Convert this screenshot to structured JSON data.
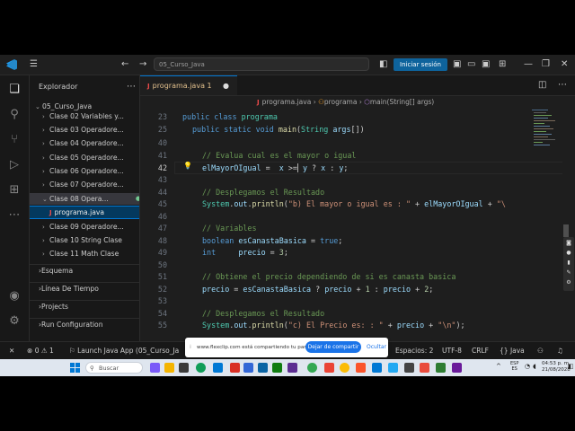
{
  "titlebar": {
    "command_center": "05_Curso_Java",
    "signin": "Iniciar sesión",
    "back_icon": "arrow-left",
    "forward_icon": "arrow-right"
  },
  "sidebar": {
    "title": "Explorador",
    "root": "05_Curso_Java",
    "items": [
      {
        "label": "Clase 02 Variables y..."
      },
      {
        "label": "Clase 03 Operadore..."
      },
      {
        "label": "Clase 04 Operadore..."
      },
      {
        "label": "Clase 05 Operadore..."
      },
      {
        "label": "Clase 06 Operadore..."
      },
      {
        "label": "Clase 07 Operadore..."
      },
      {
        "label": "Clase 08 Opera..."
      },
      {
        "label": "programa.java",
        "badge": "1"
      },
      {
        "label": "Clase 09 Operadore..."
      },
      {
        "label": "Clase 10 String Clase"
      },
      {
        "label": "Clase 11 Math Clase"
      }
    ],
    "sections": [
      "Esquema",
      "Línea De Tiempo",
      "Projects",
      "Run Configuration"
    ]
  },
  "editor": {
    "tab": {
      "label": "programa.java",
      "badge": "1"
    },
    "breadcrumbs": [
      "programa.java",
      "programa",
      "main(String[] args)"
    ],
    "sticky": [
      {
        "line": "23",
        "code": "public class programa"
      },
      {
        "line": "25",
        "code": "public static void main(String args[])"
      }
    ],
    "lines": [
      {
        "n": "40",
        "code": ""
      },
      {
        "n": "41",
        "code": "// Evalua cual es el mayor o igual"
      },
      {
        "n": "42",
        "code": "elMayorOIgual =  x >= y ? x : y;"
      },
      {
        "n": "43",
        "code": ""
      },
      {
        "n": "44",
        "code": "// Desplegamos el Resultado"
      },
      {
        "n": "45",
        "code": "System.out.println(\"b) El mayor o igual es : \" + elMayorOIgual + \"\\"
      },
      {
        "n": "46",
        "code": ""
      },
      {
        "n": "47",
        "code": "// Variables"
      },
      {
        "n": "48",
        "code": "boolean esCanastaBasica = true;"
      },
      {
        "n": "49",
        "code": "int     precio = 3;"
      },
      {
        "n": "50",
        "code": ""
      },
      {
        "n": "51",
        "code": "// Obtiene el precio dependiendo de si es canasta basica"
      },
      {
        "n": "52",
        "code": "precio = esCanastaBasica ? precio + 1 : precio + 2;"
      },
      {
        "n": "53",
        "code": ""
      },
      {
        "n": "54",
        "code": "// Desplegamos el Resultado"
      },
      {
        "n": "55",
        "code": "System.out.println(\"c) El Precio es: : \" + precio + \"\\n\");"
      }
    ]
  },
  "status": {
    "errors": "0",
    "warnings": "1",
    "launch": "Launch Java App (05_Curso_Ja",
    "spaces": "Espacios: 2",
    "encoding": "UTF-8",
    "eol": "CRLF",
    "language": "Java"
  },
  "share": {
    "text": "www.flexclip.com está compartiendo tu pantalla.",
    "stop": "Dejar de compartir",
    "hide": "Ocultar"
  },
  "taskbar": {
    "search": "Buscar",
    "lang": [
      "ESP",
      "ES"
    ],
    "time": "04:53 p. m.",
    "date": "21/08/2028"
  },
  "colors": {
    "accent": "#0078d4",
    "signin": "#0e639c",
    "keyword": "#569cd6",
    "comment": "#6a9955",
    "string": "#ce9178"
  }
}
